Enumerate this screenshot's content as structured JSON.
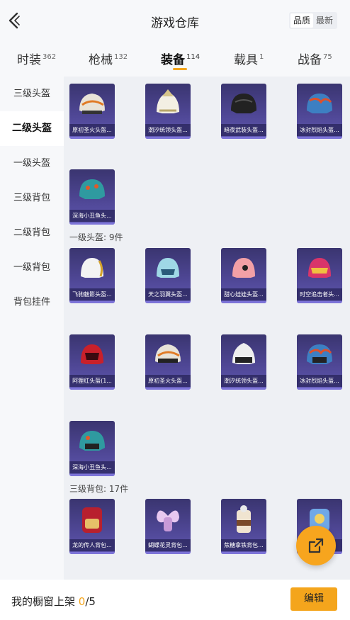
{
  "header": {
    "title": "游戏仓库",
    "sort": [
      "品质",
      "最新"
    ]
  },
  "tabs": [
    {
      "label": "时装",
      "count": "362"
    },
    {
      "label": "枪械",
      "count": "132"
    },
    {
      "label": "装备",
      "count": "114"
    },
    {
      "label": "载具",
      "count": "1"
    },
    {
      "label": "战备",
      "count": "75"
    }
  ],
  "sidebar": [
    "三级头盔",
    "二级头盔",
    "一级头盔",
    "三级背包",
    "二级背包",
    "一级背包",
    "背包挂件"
  ],
  "sections": {
    "helmet2_items": [
      "原初圣火头盔...",
      "潮汐统领头盔...",
      "暗夜武装头盔...",
      "冰封烈焰头盔...",
      "深海小丑鱼头..."
    ],
    "helmet1_title": "一级头盔: 9件",
    "helmet1_items": [
      "飞驰魅影头盔...",
      "天之羽翼头盔...",
      "甜心娃娃头盔...",
      "时空追击者头...",
      "阿狸红头盔(1...",
      "原初圣火头盔...",
      "潮汐统领头盔...",
      "冰封烈焰头盔...",
      "深海小丑鱼头..."
    ],
    "backpack3_title": "三级背包: 17件",
    "backpack3_items": [
      "龙的传人背包...",
      "蝴蝶花灵背包...",
      "焦糖拿铁背包...",
      ""
    ]
  },
  "footer": {
    "showcase_label": "我的橱窗上架",
    "count": "0",
    "total": "/5",
    "edit": "编辑"
  },
  "icons": {
    "back": "chevron-left-icon",
    "fab": "share-icon"
  },
  "colors": {
    "accent": "#f4a51c",
    "card": "#4e4694"
  }
}
